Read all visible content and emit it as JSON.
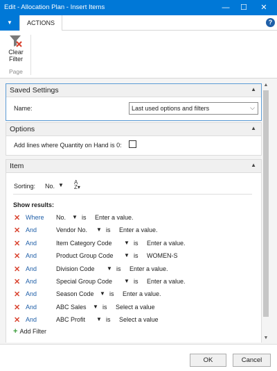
{
  "window": {
    "title": "Edit - Allocation Plan - Insert Items",
    "minimize_glyph": "—",
    "maximize_glyph": "☐",
    "close_glyph": "✕"
  },
  "ribbon": {
    "menu_glyph": "▼",
    "tab_label": "ACTIONS",
    "help_glyph": "?",
    "clear_filter_line1": "Clear",
    "clear_filter_line2": "Filter",
    "group_label": "Page"
  },
  "saved_settings": {
    "header": "Saved Settings",
    "name_label": "Name:",
    "name_value": "Last used options and filters"
  },
  "options": {
    "header": "Options",
    "add_lines_label": "Add lines where Quantity on Hand is 0:",
    "add_lines_checked": false
  },
  "item": {
    "header": "Item",
    "sorting_label": "Sorting:",
    "sorting_value": "No.",
    "show_results_label": "Show results:",
    "add_filter_label": "Add Filter",
    "filters": [
      {
        "conj": "Where",
        "field": "No.",
        "op": "is",
        "value": "Enter a value."
      },
      {
        "conj": "And",
        "field": "Vendor No.",
        "op": "is",
        "value": "Enter a value."
      },
      {
        "conj": "And",
        "field": "Item Category Code",
        "op": "is",
        "value": "Enter a value."
      },
      {
        "conj": "And",
        "field": "Product Group Code",
        "op": "is",
        "value": "WOMEN-S"
      },
      {
        "conj": "And",
        "field": "Division Code",
        "op": "is",
        "value": "Enter a value."
      },
      {
        "conj": "And",
        "field": "Special Group Code",
        "op": "is",
        "value": "Enter a value."
      },
      {
        "conj": "And",
        "field": "Season Code",
        "op": "is",
        "value": "Enter a value."
      },
      {
        "conj": "And",
        "field": "ABC Sales",
        "op": "is",
        "value": "Select a value"
      },
      {
        "conj": "And",
        "field": "ABC Profit",
        "op": "is",
        "value": "Select a value"
      }
    ]
  },
  "footer": {
    "ok_label": "OK",
    "cancel_label": "Cancel"
  },
  "colors": {
    "accent": "#0078d7",
    "remove_x": "#d9432f",
    "link_blue": "#1f5fa8",
    "add_green": "#3a9c3a"
  }
}
